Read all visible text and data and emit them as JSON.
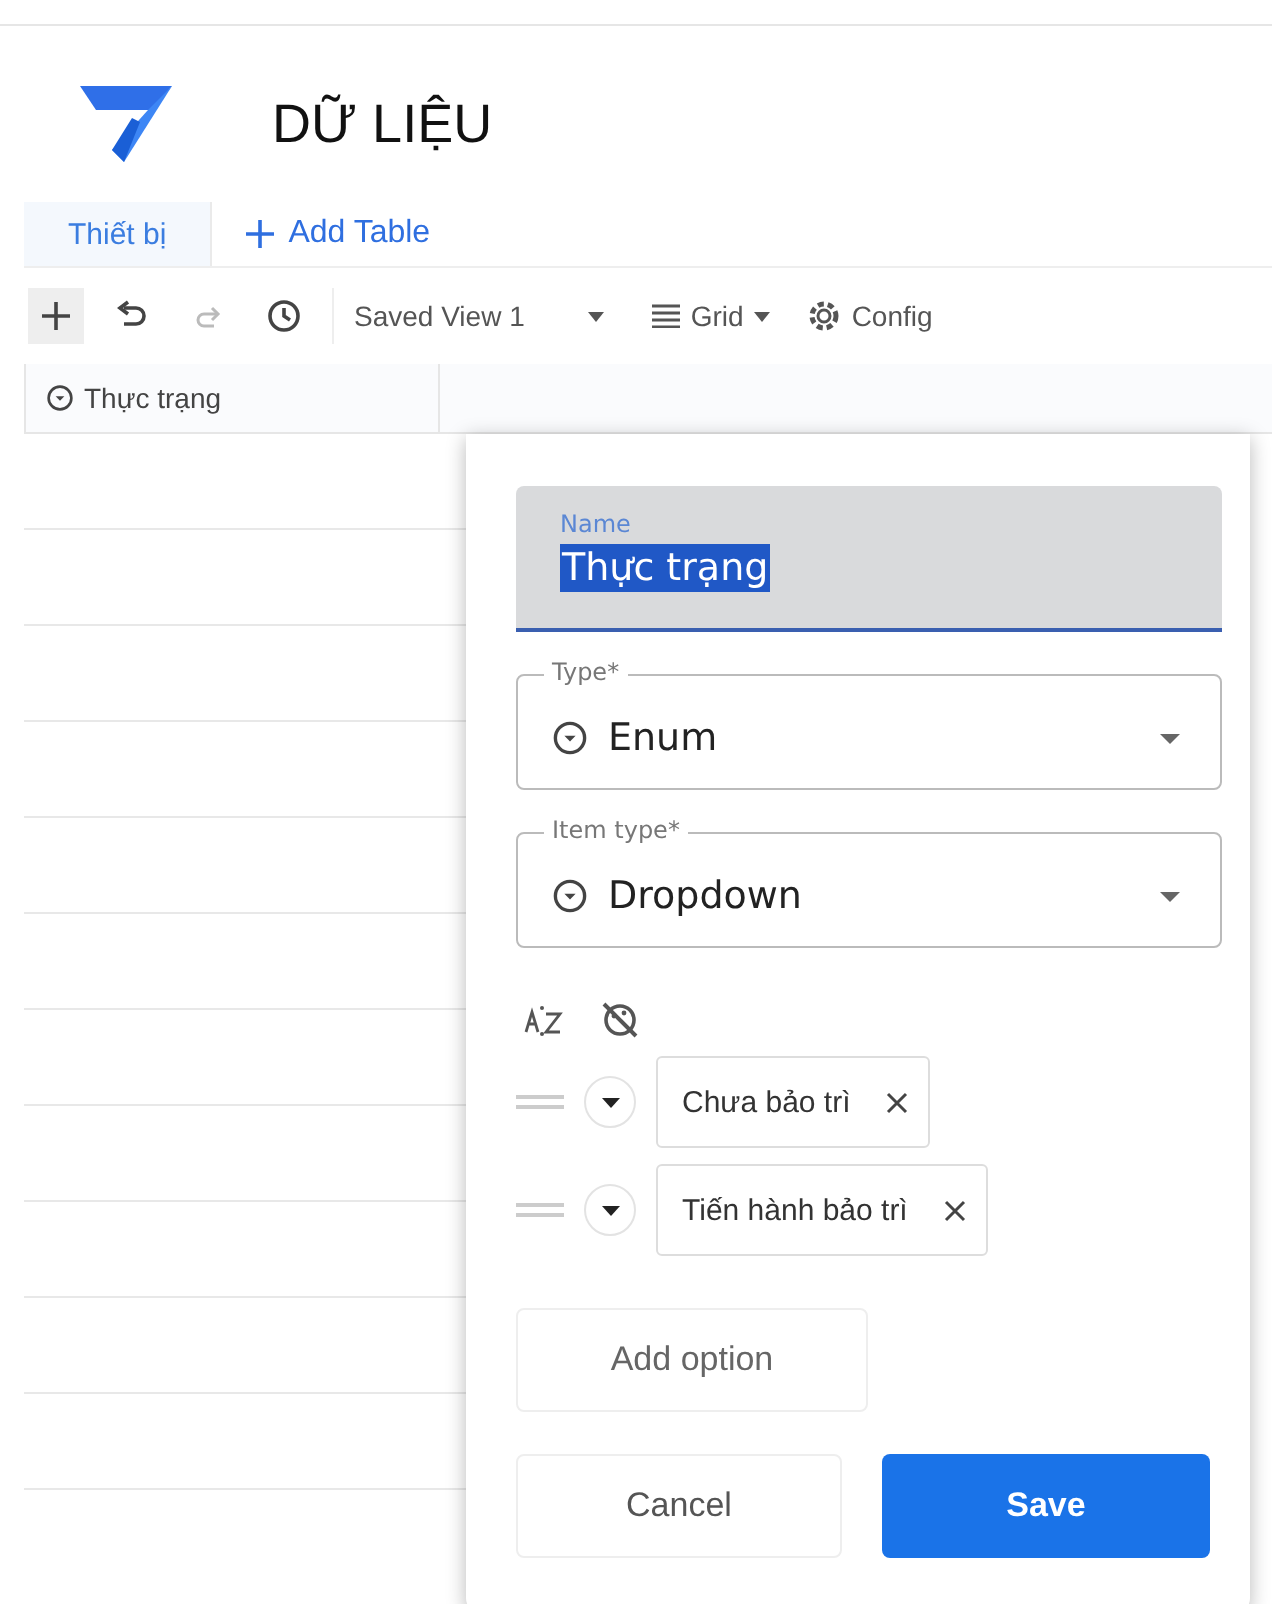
{
  "app": {
    "title": "DỮ LIỆU"
  },
  "tabs": [
    {
      "label": "Thiết bị",
      "selected": true
    }
  ],
  "add_table": "Add Table",
  "toolbar": {
    "view": "Saved View 1",
    "layout": "Grid",
    "config": "Config"
  },
  "grid": {
    "columns": [
      {
        "label": "Thực trạng"
      }
    ]
  },
  "editor": {
    "name": {
      "label": "Name",
      "value": "Thực trạng"
    },
    "type": {
      "label": "Type*",
      "value": "Enum"
    },
    "item_type": {
      "label": "Item type*",
      "value": "Dropdown"
    },
    "options": [
      {
        "label": "Chưa bảo trì"
      },
      {
        "label": "Tiến hành bảo trì"
      }
    ],
    "add_option": "Add option",
    "cancel": "Cancel",
    "save": "Save"
  }
}
